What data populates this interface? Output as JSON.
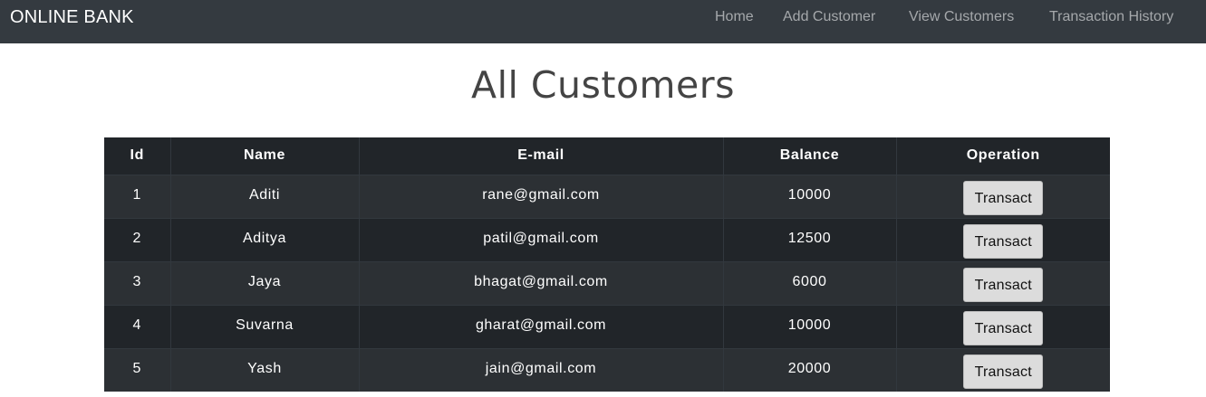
{
  "navbar": {
    "brand": "ONLINE BANK",
    "links": [
      "Home",
      "Add Customer",
      "View Customers",
      "Transaction History"
    ]
  },
  "page_title": "All Customers",
  "table": {
    "headers": [
      "Id",
      "Name",
      "E-mail",
      "Balance",
      "Operation"
    ],
    "rows": [
      {
        "id": "1",
        "name": "Aditi",
        "email": "rane@gmail.com",
        "balance": "10000",
        "action": "Transact"
      },
      {
        "id": "2",
        "name": "Aditya",
        "email": "patil@gmail.com",
        "balance": "12500",
        "action": "Transact"
      },
      {
        "id": "3",
        "name": "Jaya",
        "email": "bhagat@gmail.com",
        "balance": "6000",
        "action": "Transact"
      },
      {
        "id": "4",
        "name": "Suvarna",
        "email": "gharat@gmail.com",
        "balance": "10000",
        "action": "Transact"
      },
      {
        "id": "5",
        "name": "Yash",
        "email": "jain@gmail.com",
        "balance": "20000",
        "action": "Transact"
      }
    ]
  },
  "colors": {
    "navbar_bg": "#343a40",
    "table_header_bg": "#212529",
    "row_odd_bg": "#2c3034",
    "row_even_bg": "#212529",
    "button_bg": "#dcdcdc"
  }
}
